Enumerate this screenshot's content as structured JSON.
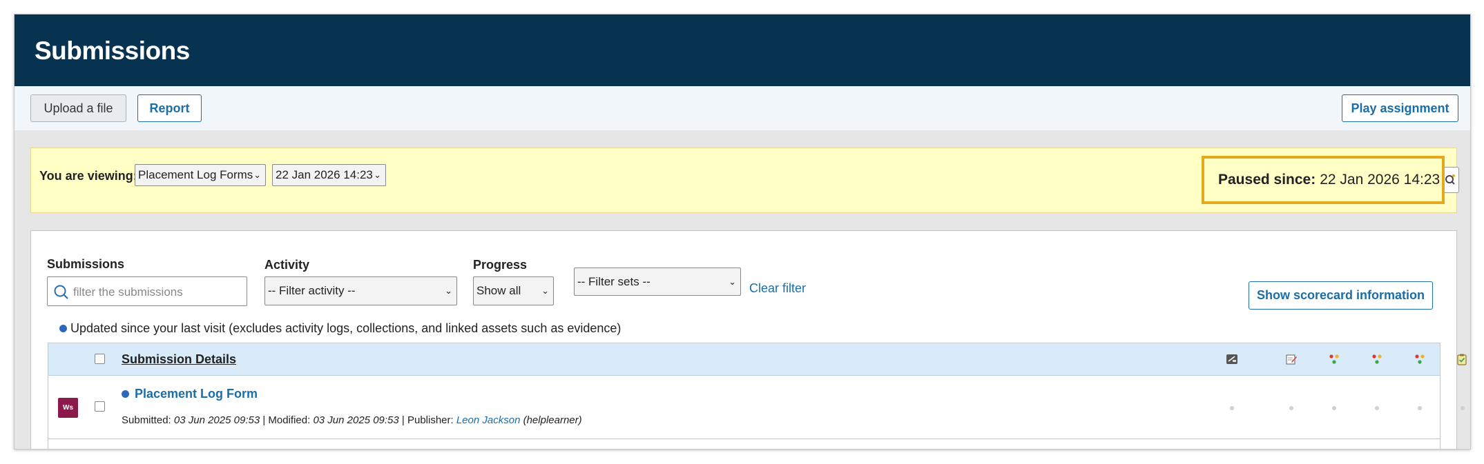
{
  "header": {
    "title": "Submissions"
  },
  "toolbar": {
    "upload_label": "Upload a file",
    "report_label": "Report",
    "play_label": "Play assignment"
  },
  "viewing": {
    "label": "You are viewing:",
    "form_select": "Placement Log Forms",
    "date_select": "22 Jan 2026 14:23",
    "paused_label": "Paused since:",
    "paused_value": "22 Jan 2026 14:23"
  },
  "filters": {
    "submissions_label": "Submissions",
    "search_placeholder": "filter the submissions",
    "activity_label": "Activity",
    "activity_value": "-- Filter activity --",
    "progress_label": "Progress",
    "progress_value": "Show all",
    "sets_value": "-- Filter sets --",
    "clear_label": "Clear filter",
    "scorecard_label": "Show scorecard information"
  },
  "legend": {
    "text": "Updated since your last visit (excludes activity logs, collections, and linked assets such as evidence)"
  },
  "table": {
    "header_title": "Submission Details",
    "header_icons": [
      "scale-icon",
      "edit-form-icon",
      "traffic-light-icon",
      "traffic-light-icon",
      "traffic-light-icon",
      "clipboard-check-icon"
    ],
    "rows": [
      {
        "badge": "Ws",
        "name": "Placement Log Form",
        "submitted_label": "Submitted:",
        "submitted": "03 Jun 2025 09:53",
        "modified_label": "| Modified:",
        "modified": "03 Jun 2025 09:53",
        "publisher_label": "| Publisher:",
        "publisher": "Leon Jackson",
        "publisher_user": "(helplearner)"
      }
    ]
  },
  "colors": {
    "header_bg": "#073350",
    "accent": "#1a6ea8",
    "highlight_border": "#e4a81e",
    "notice_bg": "#ffffc6"
  }
}
